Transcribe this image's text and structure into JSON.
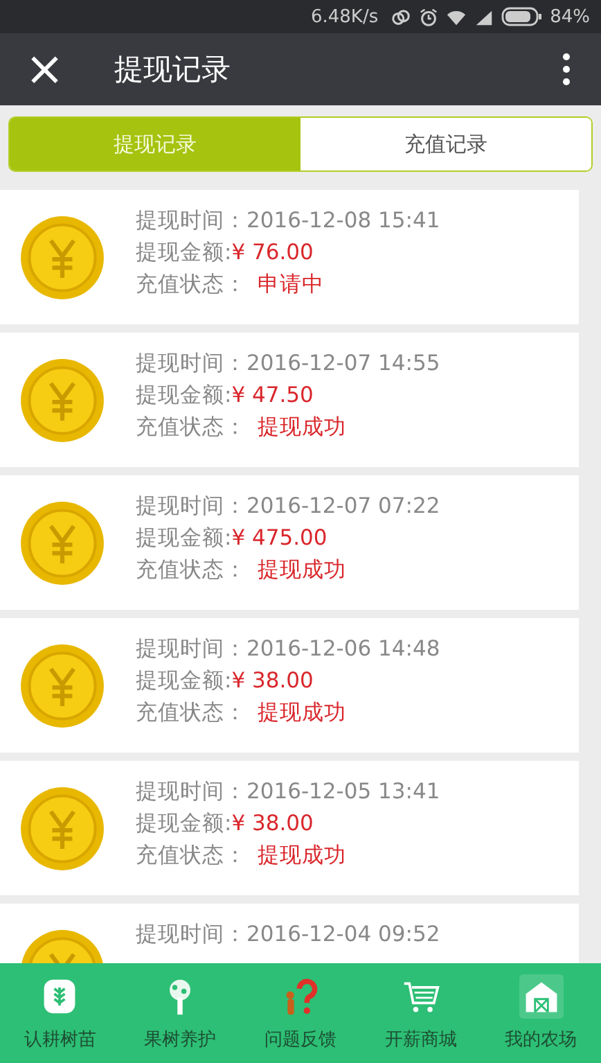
{
  "status_bar": {
    "speed": "6.48K/s",
    "battery": "84%"
  },
  "header": {
    "close": "×",
    "title": "提现记录"
  },
  "tabs": [
    {
      "label": "提现记录",
      "selected": true
    },
    {
      "label": "充值记录",
      "selected": false
    }
  ],
  "records": [
    {
      "time_label": "提现时间：",
      "time": "2016-12-08 15:41",
      "amount_label": "提现金额:",
      "amount": "¥ 76.00",
      "status_label": "充值状态：",
      "status": "申请中"
    },
    {
      "time_label": "提现时间：",
      "time": "2016-12-07 14:55",
      "amount_label": "提现金额:",
      "amount": "¥ 47.50",
      "status_label": "充值状态：",
      "status": "提现成功"
    },
    {
      "time_label": "提现时间：",
      "time": "2016-12-07 07:22",
      "amount_label": "提现金额:",
      "amount": "¥ 475.00",
      "status_label": "充值状态：",
      "status": "提现成功"
    },
    {
      "time_label": "提现时间：",
      "time": "2016-12-06 14:48",
      "amount_label": "提现金额:",
      "amount": "¥ 38.00",
      "status_label": "充值状态：",
      "status": "提现成功"
    },
    {
      "time_label": "提现时间：",
      "time": "2016-12-05 13:41",
      "amount_label": "提现金额:",
      "amount": "¥ 38.00",
      "status_label": "充值状态：",
      "status": "提现成功"
    },
    {
      "time_label": "提现时间：",
      "time": "2016-12-04 09:52"
    }
  ],
  "nav": [
    {
      "label": "认耕树苗",
      "kind": "seedling",
      "selected": false
    },
    {
      "label": "果树养护",
      "kind": "tree",
      "selected": false
    },
    {
      "label": "问题反馈",
      "kind": "question",
      "selected": false
    },
    {
      "label": "开薪商城",
      "kind": "cart",
      "selected": false
    },
    {
      "label": "我的农场",
      "kind": "farm",
      "selected": true
    }
  ]
}
